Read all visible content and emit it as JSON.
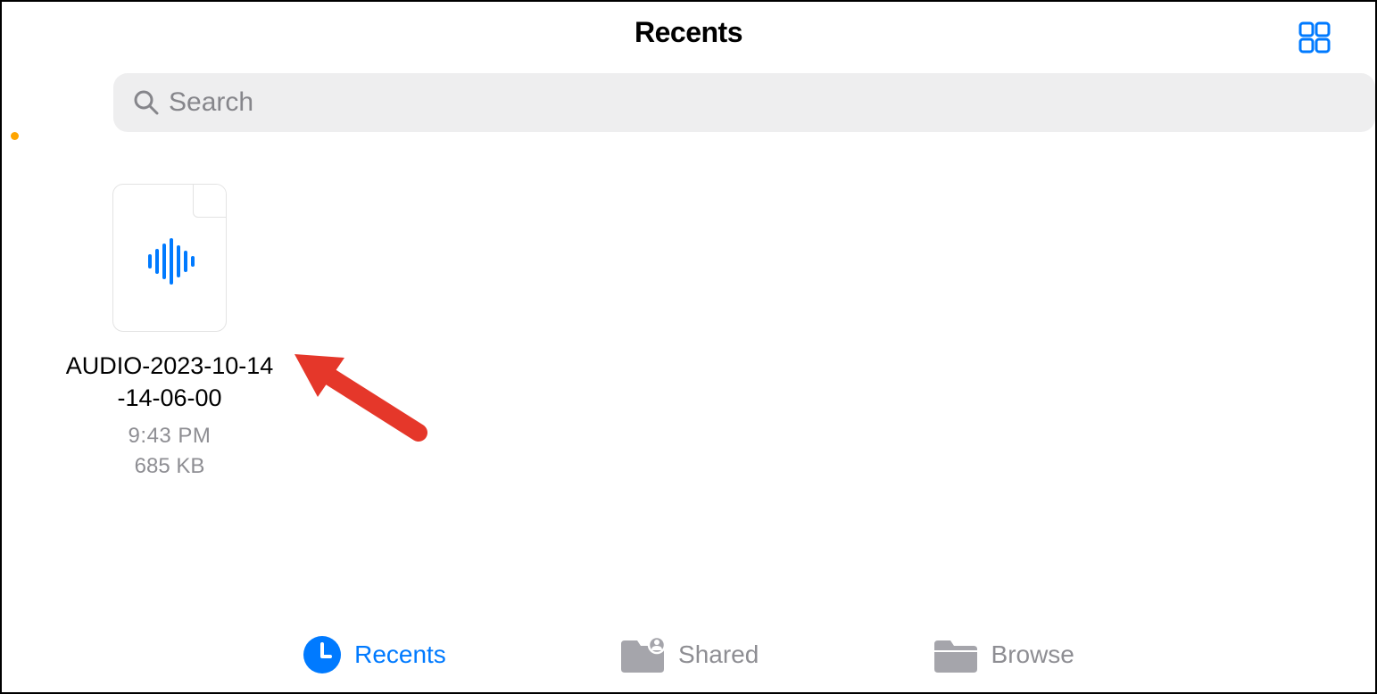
{
  "header": {
    "title": "Recents"
  },
  "search": {
    "placeholder": "Search"
  },
  "files": [
    {
      "name": "AUDIO-2023-10-14-14-06-00",
      "time": "9:43 PM",
      "size": "685 KB",
      "type": "audio"
    }
  ],
  "tabs": {
    "recents": "Recents",
    "shared": "Shared",
    "browse": "Browse"
  },
  "colors": {
    "accent": "#007aff",
    "muted": "#8e8e93",
    "searchBg": "#eeeeef",
    "annotation": "#e5372a"
  }
}
